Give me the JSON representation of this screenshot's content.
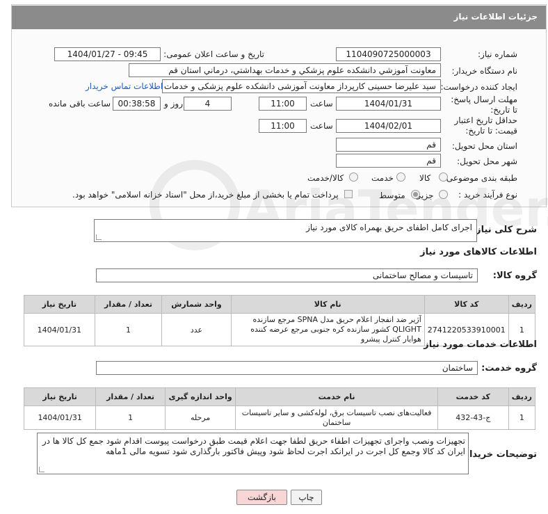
{
  "header": {
    "title": "جزئیات اطلاعات نیاز"
  },
  "labels": {
    "need_number": "شماره نیاز:",
    "announce_datetime": "تاریخ و ساعت اعلان عمومی:",
    "buyer_org": "نام دستگاه خریدار:",
    "requester": "ایجاد کننده درخواست:",
    "reply_deadline": "مهلت ارسال پاسخ: تا تاریخ:",
    "time": "ساعت",
    "day_and": "روز و",
    "remaining": "ساعت باقی مانده",
    "price_validity": "حداقل تاریخ اعتبار قیمت: تا تاریخ:",
    "delivery_province": "استان محل تحویل:",
    "delivery_city": "شهر محل تحویل:",
    "category": "طبقه بندی موضوعی:",
    "process_type": "نوع فرآیند خرید :",
    "summary": "شرح کلی نیاز:",
    "goods_section": "اطلاعات کالاهای مورد نیاز",
    "goods_group": "گروه کالا:",
    "services_section": "اطلاعات خدمات مورد نیاز",
    "service_group": "گروه خدمت:",
    "buyer_notes": "توضیحات خریدار:"
  },
  "fields": {
    "need_number": "1104090725000003",
    "announce_datetime": "1404/01/27 - 09:45",
    "buyer_org": "معاونت آموزشي دانشكده علوم پزشكي و خدمات بهداشتي، درماني استان قم",
    "requester": "سید علیرضا حسینی کارپرداز معاونت آموزشی دانشکده علوم پزشکی و خدمات",
    "contact_link": "اطلاعات تماس خریدار",
    "reply_date": "1404/01/31",
    "reply_time": "11:00",
    "days_left": "4",
    "time_left": "00:38:58",
    "validity_date": "1404/02/01",
    "validity_time": "11:00",
    "province": "قم",
    "city": "قم"
  },
  "category_options": [
    {
      "label": "کالا",
      "selected": false
    },
    {
      "label": "خدمت",
      "selected": false
    },
    {
      "label": "کالا/خدمت",
      "selected": false
    }
  ],
  "process_options": [
    {
      "label": "جزیی",
      "selected": false
    },
    {
      "label": "متوسط",
      "selected": true
    }
  ],
  "process_note": "پرداخت تمام یا بخشی از مبلغ خرید،از محل \"اسناد خزانه اسلامی\" خواهد بود.",
  "summary": "اجرای کامل اطفای حریق بهمراه کالای مورد نیاز",
  "goods_group": "تاسیسات و مصالح ساختمانی",
  "goods_table": {
    "headers": [
      "ردیف",
      "کد کالا",
      "نام کالا",
      "واحد شمارش",
      "تعداد / مقدار",
      "تاریخ نیاز"
    ],
    "rows": [
      [
        "1",
        "2741220533910001",
        "آژیر ضد انفجار اعلام حریق مدل SPNA مرجع سازنده QLIGHT کشور سازنده کره جنوبی مرجع عرضه کننده هوایار کنترل پیشرو",
        "عدد",
        "1",
        "1404/01/31"
      ]
    ]
  },
  "service_group": "ساختمان",
  "services_table": {
    "headers": [
      "ردیف",
      "کد خدمت",
      "نام خدمت",
      "واحد اندازه گیری",
      "تعداد / مقدار",
      "تاریخ نیاز"
    ],
    "rows": [
      [
        "1",
        "ج-43-432",
        "فعالیت‌های نصب تاسیسات برق، لوله‌کشی و سایر تاسیسات ساختمان",
        "مرحله",
        "1",
        "1404/01/31"
      ]
    ]
  },
  "buyer_notes": "تجهیزات ونصب واجرای تجهیزات اطفاء حریق لطفا جهت اعلام قیمت طبق درخواست پیوست اقدام شود جمع کل کالا ها در ایران کد کالا وجمع کل اجرت در ایرانکد اجرت لحاظ شود وپیش فاکتور بارگذاری شود تسویه مالی 1ماهه",
  "buttons": {
    "print": "چاپ",
    "back": "بازگشت"
  },
  "watermark_text": "AriaTender.neT",
  "colors": {
    "header_bg": "#8b8b8b",
    "link": "#1a5bc7",
    "back_button_bg": "#f9d6d6"
  }
}
